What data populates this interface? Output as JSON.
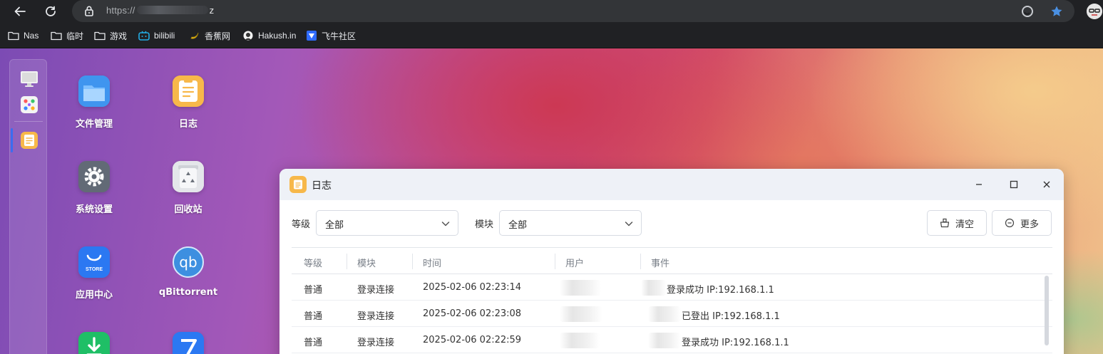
{
  "browser": {
    "url_prefix": "https://",
    "url_suffix": "z",
    "bookmarks": [
      {
        "label": "Nas",
        "icon": "folder-icon"
      },
      {
        "label": "临时",
        "icon": "folder-icon"
      },
      {
        "label": "游戏",
        "icon": "folder-icon"
      },
      {
        "label": "bilibili",
        "icon": "bilibili-icon"
      },
      {
        "label": "香蕉网",
        "icon": "banana-icon"
      },
      {
        "label": "Hakush.in",
        "icon": "hakush-icon"
      },
      {
        "label": "飞牛社区",
        "icon": "fnos-community-icon"
      }
    ]
  },
  "desktop": {
    "apps": [
      {
        "label": "文件管理",
        "icon": "folder-app-icon"
      },
      {
        "label": "日志",
        "icon": "log-app-icon"
      },
      {
        "label": "系统设置",
        "icon": "settings-app-icon"
      },
      {
        "label": "回收站",
        "icon": "recycle-bin-icon"
      },
      {
        "label": "应用中心",
        "icon": "app-store-icon",
        "badge": "STORE"
      },
      {
        "label": "qBittorrent",
        "icon": "qbittorrent-icon",
        "badge": "qb"
      }
    ]
  },
  "log_window": {
    "title": "日志",
    "filters": {
      "level_label": "等级",
      "level_value": "全部",
      "module_label": "模块",
      "module_value": "全部"
    },
    "buttons": {
      "clear": "清空",
      "more": "更多"
    },
    "columns": [
      "等级",
      "模块",
      "时间",
      "用户",
      "事件"
    ],
    "rows": [
      {
        "level": "普通",
        "module": "登录连接",
        "time": "2025-02-06 02:23:14",
        "user": "",
        "event": "登录成功 IP:192.168.1.1"
      },
      {
        "level": "普通",
        "module": "登录连接",
        "time": "2025-02-06 02:23:08",
        "user": "",
        "event": "已登出 IP:192.168.1.1"
      },
      {
        "level": "普通",
        "module": "登录连接",
        "time": "2025-02-06 02:22:59",
        "user": "",
        "event": "登录成功 IP:192.168.1.1"
      }
    ]
  },
  "colors": {
    "accent": "#3b6cf0",
    "log_icon": "#f7b84a",
    "window_title_bg": "#eef1f7"
  }
}
